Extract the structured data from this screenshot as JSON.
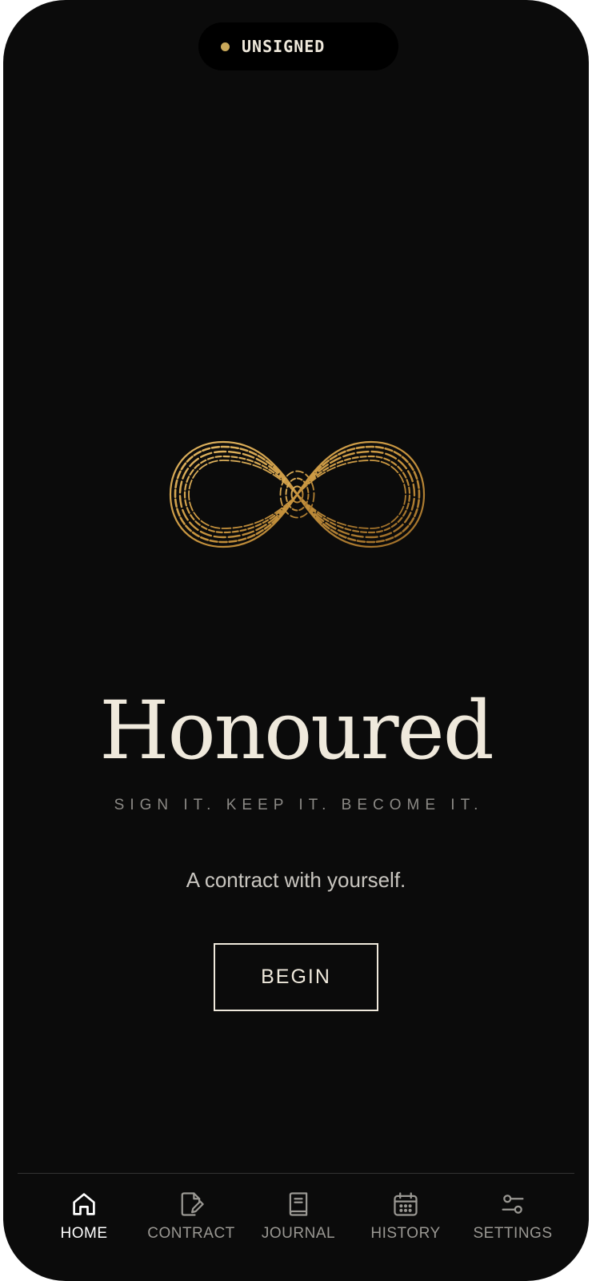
{
  "colors": {
    "background": "#0b0b0b",
    "status_pill": "#000000",
    "status_dot": "#c9a85a",
    "gold": "#c8953f",
    "cream": "#efe9dc",
    "tagline": "#8c8a86",
    "subtitle": "#c9c6c0",
    "tab_active": "#ffffff",
    "tab_inactive": "#9a9893"
  },
  "status": {
    "label": "UNSIGNED"
  },
  "hero": {
    "logo_icon": "infinity-fingerprint-icon",
    "title": "Honoured",
    "tagline": "SIGN IT. KEEP IT. BECOME IT.",
    "subtitle": "A contract with yourself.",
    "cta_label": "BEGIN"
  },
  "tabs": [
    {
      "label": "HOME",
      "icon": "home-icon",
      "active": true
    },
    {
      "label": "CONTRACT",
      "icon": "document-edit-icon",
      "active": false
    },
    {
      "label": "JOURNAL",
      "icon": "book-icon",
      "active": false
    },
    {
      "label": "HISTORY",
      "icon": "calendar-icon",
      "active": false
    },
    {
      "label": "SETTINGS",
      "icon": "sliders-icon",
      "active": false
    }
  ]
}
